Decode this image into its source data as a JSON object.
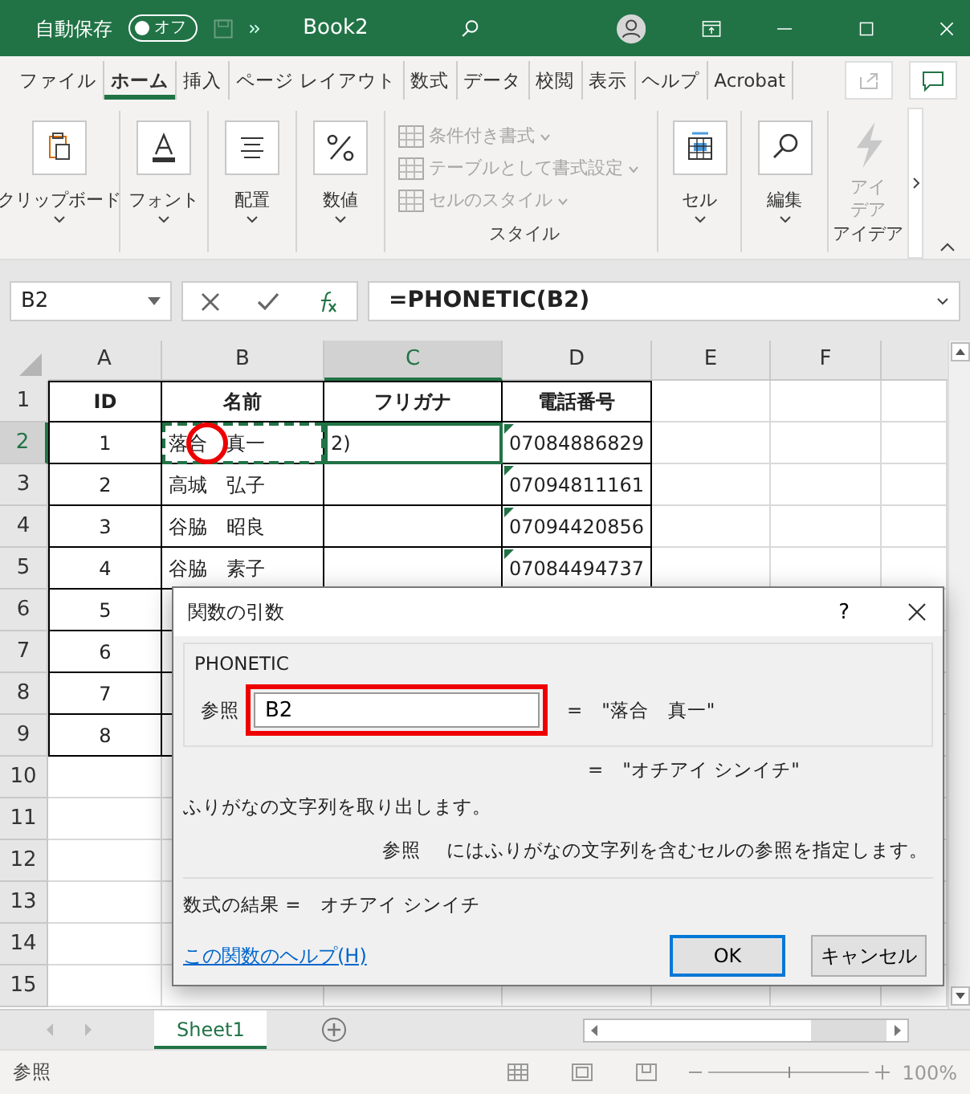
{
  "title_bar": {
    "autosave_label": "自動保存",
    "autosave_toggle": {
      "label": "オフ",
      "on": false
    },
    "document": "Book2"
  },
  "ribbon_tabs": [
    {
      "label": "ファイル",
      "selected": false
    },
    {
      "label": "ホーム",
      "selected": true
    },
    {
      "label": "挿入",
      "selected": false
    },
    {
      "label": "ページ レイアウト",
      "selected": false
    },
    {
      "label": "数式",
      "selected": false
    },
    {
      "label": "データ",
      "selected": false
    },
    {
      "label": "校閲",
      "selected": false
    },
    {
      "label": "表示",
      "selected": false
    },
    {
      "label": "ヘルプ",
      "selected": false
    },
    {
      "label": "Acrobat",
      "selected": false
    }
  ],
  "ribbon_groups": [
    {
      "kind": "big",
      "label": "クリップボード",
      "disabled": false
    },
    {
      "kind": "big",
      "label": "フォント",
      "disabled": false
    },
    {
      "kind": "big",
      "label": "配置",
      "disabled": false
    },
    {
      "kind": "big",
      "label": "数値",
      "disabled": false
    },
    {
      "kind": "list",
      "group_label": "スタイル",
      "items": [
        {
          "label": "条件付き書式",
          "disabled": true
        },
        {
          "label": "テーブルとして書式設定",
          "disabled": true
        },
        {
          "label": "セルのスタイル",
          "disabled": true
        }
      ]
    },
    {
      "kind": "big",
      "label": "セル",
      "disabled": false
    },
    {
      "kind": "big",
      "label": "編集",
      "disabled": false
    },
    {
      "kind": "idea",
      "label": "アイデア",
      "group_label": "アイデア",
      "disabled": true
    }
  ],
  "formula_bar": {
    "name_box": "B2",
    "formula": "=PHONETIC(B2)"
  },
  "columns": [
    {
      "label": "A",
      "selected": false
    },
    {
      "label": "B",
      "selected": false
    },
    {
      "label": "C",
      "selected": true
    },
    {
      "label": "D",
      "selected": false
    },
    {
      "label": "E",
      "selected": false
    },
    {
      "label": "F",
      "selected": false
    }
  ],
  "rows": [
    {
      "label": "1",
      "selected": false,
      "cells": [
        {
          "text": "ID",
          "kind": "heading"
        },
        {
          "text": "名前",
          "kind": "heading"
        },
        {
          "text": "フリガナ",
          "kind": "heading"
        },
        {
          "text": "電話番号",
          "kind": "heading"
        }
      ]
    },
    {
      "label": "2",
      "selected": true,
      "cells": [
        {
          "text": "1",
          "kind": "number"
        },
        {
          "text": "落合　真一",
          "kind": "text",
          "marquee": true
        },
        {
          "text": "2)",
          "kind": "text",
          "active": true
        },
        {
          "text": "07084886829",
          "kind": "text",
          "flag": true
        }
      ]
    },
    {
      "label": "3",
      "selected": false,
      "cells": [
        {
          "text": "2",
          "kind": "number"
        },
        {
          "text": "高城　弘子",
          "kind": "text"
        },
        {
          "text": "",
          "kind": "text"
        },
        {
          "text": "07094811161",
          "kind": "text",
          "flag": true
        }
      ]
    },
    {
      "label": "4",
      "selected": false,
      "cells": [
        {
          "text": "3",
          "kind": "number"
        },
        {
          "text": "谷脇　昭良",
          "kind": "text"
        },
        {
          "text": "",
          "kind": "text"
        },
        {
          "text": "07094420856",
          "kind": "text",
          "flag": true
        }
      ]
    },
    {
      "label": "5",
      "selected": false,
      "cells": [
        {
          "text": "4",
          "kind": "number"
        },
        {
          "text": "谷脇　素子",
          "kind": "text"
        },
        {
          "text": "",
          "kind": "text"
        },
        {
          "text": "07084494737",
          "kind": "text",
          "flag": true
        }
      ]
    },
    {
      "label": "6",
      "selected": false,
      "cells": [
        {
          "text": "5",
          "kind": "number"
        }
      ]
    },
    {
      "label": "7",
      "selected": false,
      "cells": [
        {
          "text": "6",
          "kind": "number"
        }
      ]
    },
    {
      "label": "8",
      "selected": false,
      "cells": [
        {
          "text": "7",
          "kind": "number"
        }
      ]
    },
    {
      "label": "9",
      "selected": false,
      "cells": [
        {
          "text": "8",
          "kind": "number"
        }
      ]
    },
    {
      "label": "10",
      "selected": false,
      "cells": []
    },
    {
      "label": "11",
      "selected": false,
      "cells": []
    },
    {
      "label": "12",
      "selected": false,
      "cells": []
    },
    {
      "label": "13",
      "selected": false,
      "cells": []
    },
    {
      "label": "14",
      "selected": false,
      "cells": []
    },
    {
      "label": "15",
      "selected": false,
      "cells": []
    }
  ],
  "dialog": {
    "title": "関数の引数",
    "help": "?",
    "function_name": "PHONETIC",
    "argument_label": "参照",
    "argument_value": "B2",
    "argument_equals": "=",
    "argument_preview": "\"落合　真一\"",
    "result_equals": "=",
    "result_preview": "\"オチアイ シンイチ\"",
    "description": "ふりがなの文字列を取り出します。",
    "argument_help_name": "参照",
    "argument_help": "にはふりがなの文字列を含むセルの参照を指定します。",
    "formula_result": "数式の結果 =　オチアイ シンイチ",
    "help_link": "この関数のヘルプ(H)",
    "buttons": [
      {
        "label": "OK",
        "default": true
      },
      {
        "label": "キャンセル",
        "default": false
      }
    ]
  },
  "sheet_tabs": [
    {
      "label": "Sheet1",
      "selected": true
    }
  ],
  "status_bar": {
    "mode": "参照",
    "zoom_slider": {
      "level": 0.5
    },
    "zoom": "100%"
  }
}
